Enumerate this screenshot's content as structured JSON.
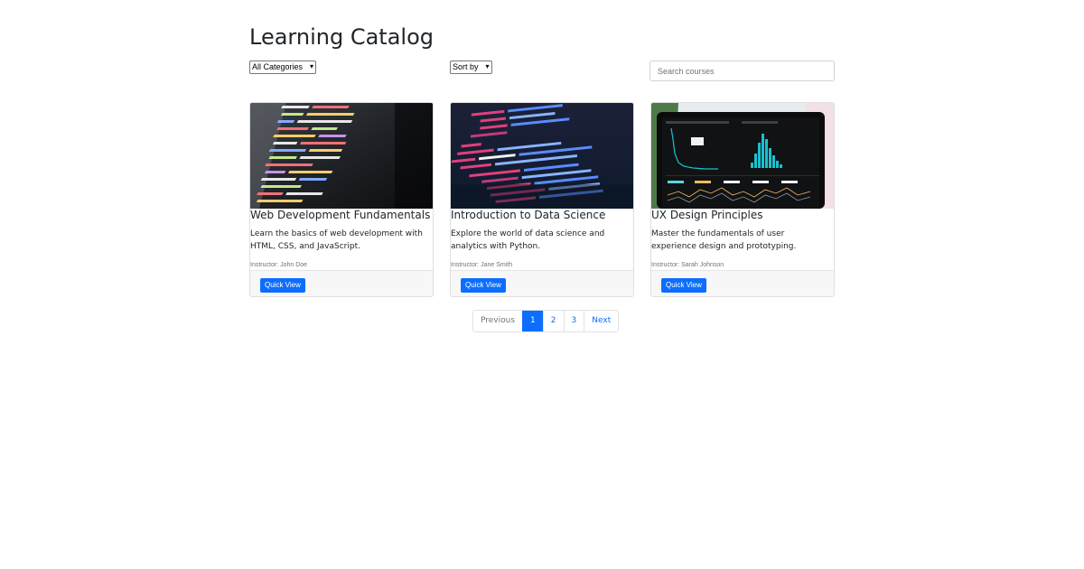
{
  "page": {
    "title": "Learning Catalog"
  },
  "filters": {
    "category": {
      "selected": "All Categories"
    },
    "sort": {
      "selected": "Sort by"
    },
    "search": {
      "placeholder": "Search courses"
    }
  },
  "courses": [
    {
      "title": "Web Development Fundamentals",
      "description": "Learn the basics of web development with HTML, CSS, and JavaScript.",
      "instructor": "Instructor: John Doe",
      "button": "Quick View",
      "image": "code-editor-screenshot"
    },
    {
      "title": "Introduction to Data Science",
      "description": "Explore the world of data science and analytics with Python.",
      "instructor": "Instructor: Jane Smith",
      "button": "Quick View",
      "image": "html-code-screenshot"
    },
    {
      "title": "UX Design Principles",
      "description": "Master the fundamentals of user experience design and prototyping.",
      "instructor": "Instructor: Sarah Johnson",
      "button": "Quick View",
      "image": "analytics-dashboard-laptop"
    }
  ],
  "pagination": {
    "previous": "Previous",
    "pages": [
      "1",
      "2",
      "3"
    ],
    "active": "1",
    "next": "Next"
  },
  "colors": {
    "primary": "#0d6efd",
    "text": "#212529",
    "muted": "#6c757d",
    "footer_bg": "#f7f7f7"
  }
}
